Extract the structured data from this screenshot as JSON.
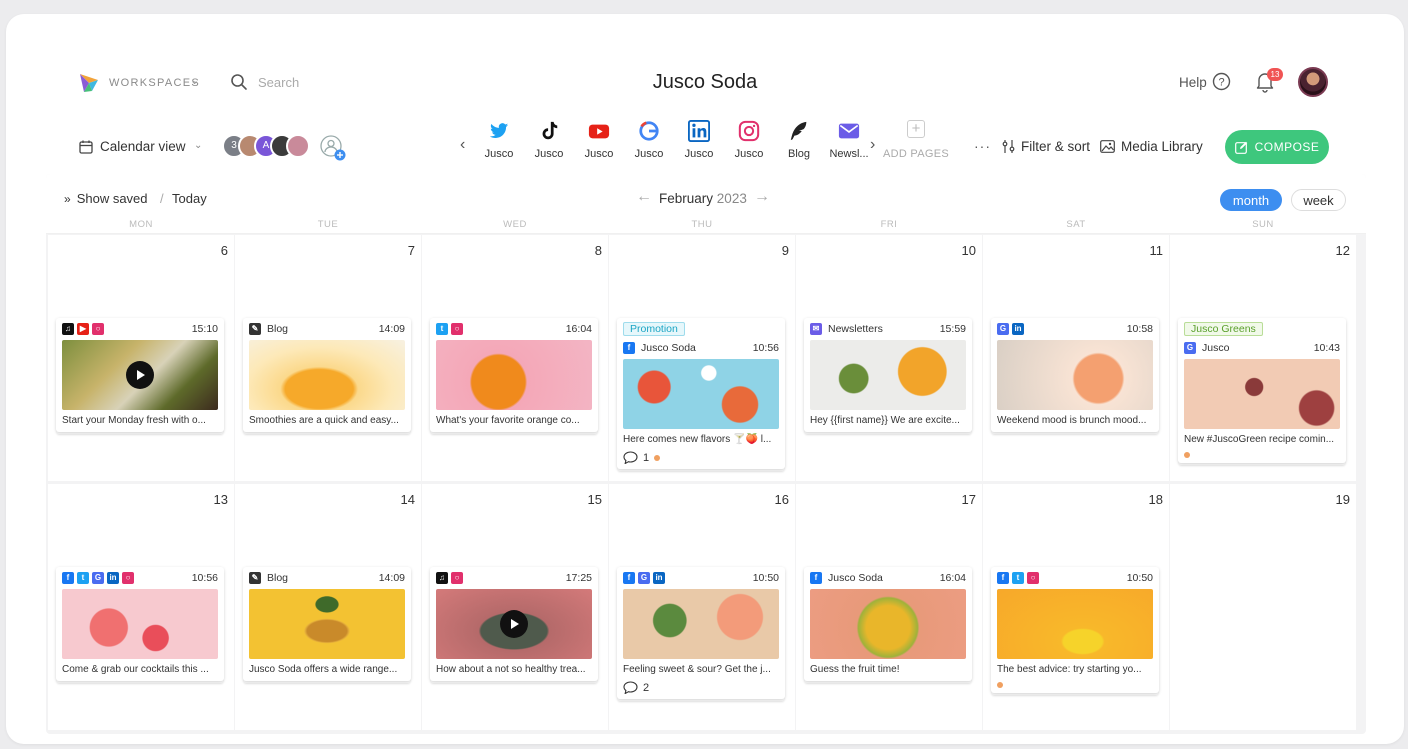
{
  "header": {
    "workspaces_label": "WORKSPACES",
    "search_placeholder": "Search",
    "title": "Jusco Soda",
    "help_label": "Help",
    "notification_count": "13"
  },
  "toolbar": {
    "view_label": "Calendar view",
    "member_count": "3",
    "member_initial": "A",
    "add_pages_label": "ADD PAGES",
    "filter_label": "Filter & sort",
    "media_label": "Media Library",
    "compose_label": "COMPOSE"
  },
  "page_tabs": [
    {
      "icon": "twitter-icon",
      "label": "Jusco",
      "color": "#1da1f2"
    },
    {
      "icon": "tiktok-icon",
      "label": "Jusco",
      "color": "#111111"
    },
    {
      "icon": "youtube-icon",
      "label": "Jusco",
      "color": "#e62117"
    },
    {
      "icon": "google-icon",
      "label": "Jusco",
      "color": "#4285f4"
    },
    {
      "icon": "linkedin-icon",
      "label": "Jusco",
      "color": "#0a66c2"
    },
    {
      "icon": "instagram-icon",
      "label": "Jusco",
      "color": "#e1306c"
    },
    {
      "icon": "blog-icon",
      "label": "Blog",
      "color": "#333333"
    },
    {
      "icon": "newsletter-icon",
      "label": "Newsl...",
      "color": "#6b5ce7"
    }
  ],
  "calendar": {
    "show_saved": "Show saved",
    "today": "Today",
    "month": "February",
    "year": "2023",
    "month_btn": "month",
    "week_btn": "week",
    "weekdays": [
      "MON",
      "TUE",
      "WED",
      "THU",
      "FRI",
      "SAT",
      "SUN"
    ],
    "week1_days": [
      "6",
      "7",
      "8",
      "9",
      "10",
      "11",
      "12"
    ],
    "week2_days": [
      "13",
      "14",
      "15",
      "16",
      "17",
      "18",
      "19"
    ]
  },
  "posts": {
    "mon6": {
      "time": "15:10",
      "caption": "Start your Monday fresh with o..."
    },
    "tue7": {
      "account": "Blog",
      "time": "14:09",
      "caption": "Smoothies are a quick and easy..."
    },
    "wed8": {
      "time": "16:04",
      "caption": "What's your favorite orange co..."
    },
    "thu9": {
      "tag": "Promotion",
      "account": "Jusco Soda",
      "time": "10:56",
      "caption": "Here comes new flavors 🍸🍑 l...",
      "comments": "1"
    },
    "fri10": {
      "account": "Newsletters",
      "time": "15:59",
      "caption": "Hey {{first name}} We are excite..."
    },
    "sat11": {
      "time": "10:58",
      "caption": "Weekend mood is brunch mood..."
    },
    "sun12": {
      "tag": "Jusco Greens",
      "account": "Jusco",
      "time": "10:43",
      "caption": "New #JuscoGreen recipe comin..."
    },
    "mon13": {
      "time": "10:56",
      "caption": "Come & grab our cocktails this ..."
    },
    "tue14": {
      "account": "Blog",
      "time": "14:09",
      "caption": "Jusco Soda offers a wide range..."
    },
    "wed15": {
      "time": "17:25",
      "caption": "How about a not so healthy trea..."
    },
    "thu16": {
      "time": "10:50",
      "caption": "Feeling sweet & sour? Get the j...",
      "comments": "2"
    },
    "fri17": {
      "account": "Jusco Soda",
      "time": "16:04",
      "caption": "Guess the fruit time!"
    },
    "sat18": {
      "time": "10:50",
      "caption": "The best advice: try starting yo..."
    }
  },
  "colors": {
    "compose": "#3ec77d",
    "month_active": "#3d8ef0",
    "promotion_tag": "#1ba5c4",
    "greens_tag": "#5aa02c"
  }
}
